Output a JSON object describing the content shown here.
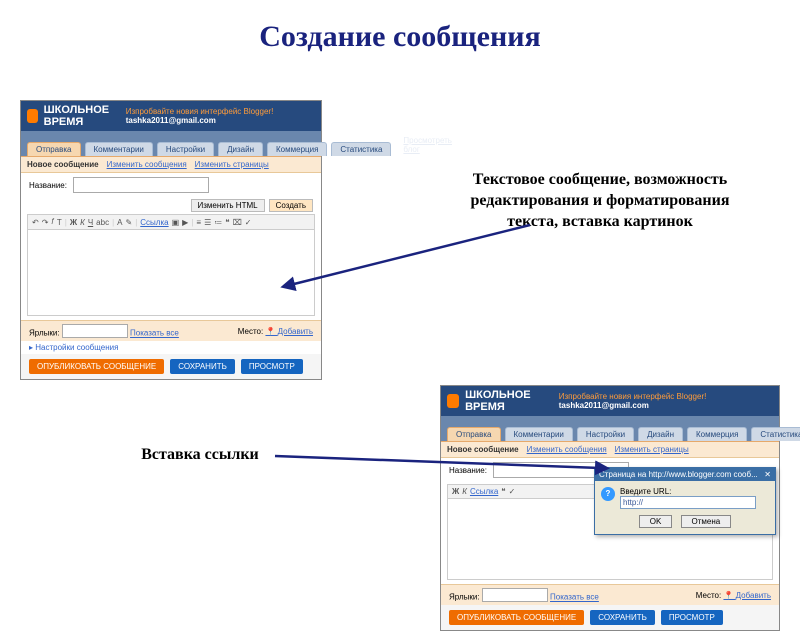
{
  "slide": {
    "title": "Создание сообщения",
    "caption_right": "Текстовое сообщение, возможность редактирования и форматирования текста, вставка картинок",
    "caption_left": "Вставка ссылки"
  },
  "blogger": {
    "brand": "ШКОЛЬНОЕ ВРЕМЯ",
    "user_try": "Изпробвайте новия интерфейс Blogger!",
    "user_email": "tashka2011@gmail.com",
    "tabs": [
      "Отправка",
      "Комментарии",
      "Настройки",
      "Дизайн",
      "Коммерция",
      "Статистика"
    ],
    "view_blog": "Просмотреть блог",
    "subtabs": {
      "new": "Новое сообщение",
      "edit": "Изменить сообщения",
      "pages": "Изменить страницы"
    },
    "title_label": "Название:",
    "mode": {
      "html": "Изменить HTML",
      "compose": "Создать"
    },
    "toolbar": {
      "link": "Ссылка"
    },
    "tags_label": "Ярлыки:",
    "show_all": "Показать все",
    "location": "Место:",
    "add": "Добавить",
    "settings_link": "▸ Настройки сообщения",
    "publish": "ОПУБЛИКОВАТЬ СООБЩЕНИЕ",
    "save": "СОХРАНИТЬ",
    "preview": "ПРОСМОТР"
  },
  "popup": {
    "title": "Страница на http://www.blogger.com сооб...",
    "prompt": "Введите URL:",
    "value": "http://",
    "ok": "OK",
    "cancel": "Отмена",
    "close_x": "✕"
  }
}
